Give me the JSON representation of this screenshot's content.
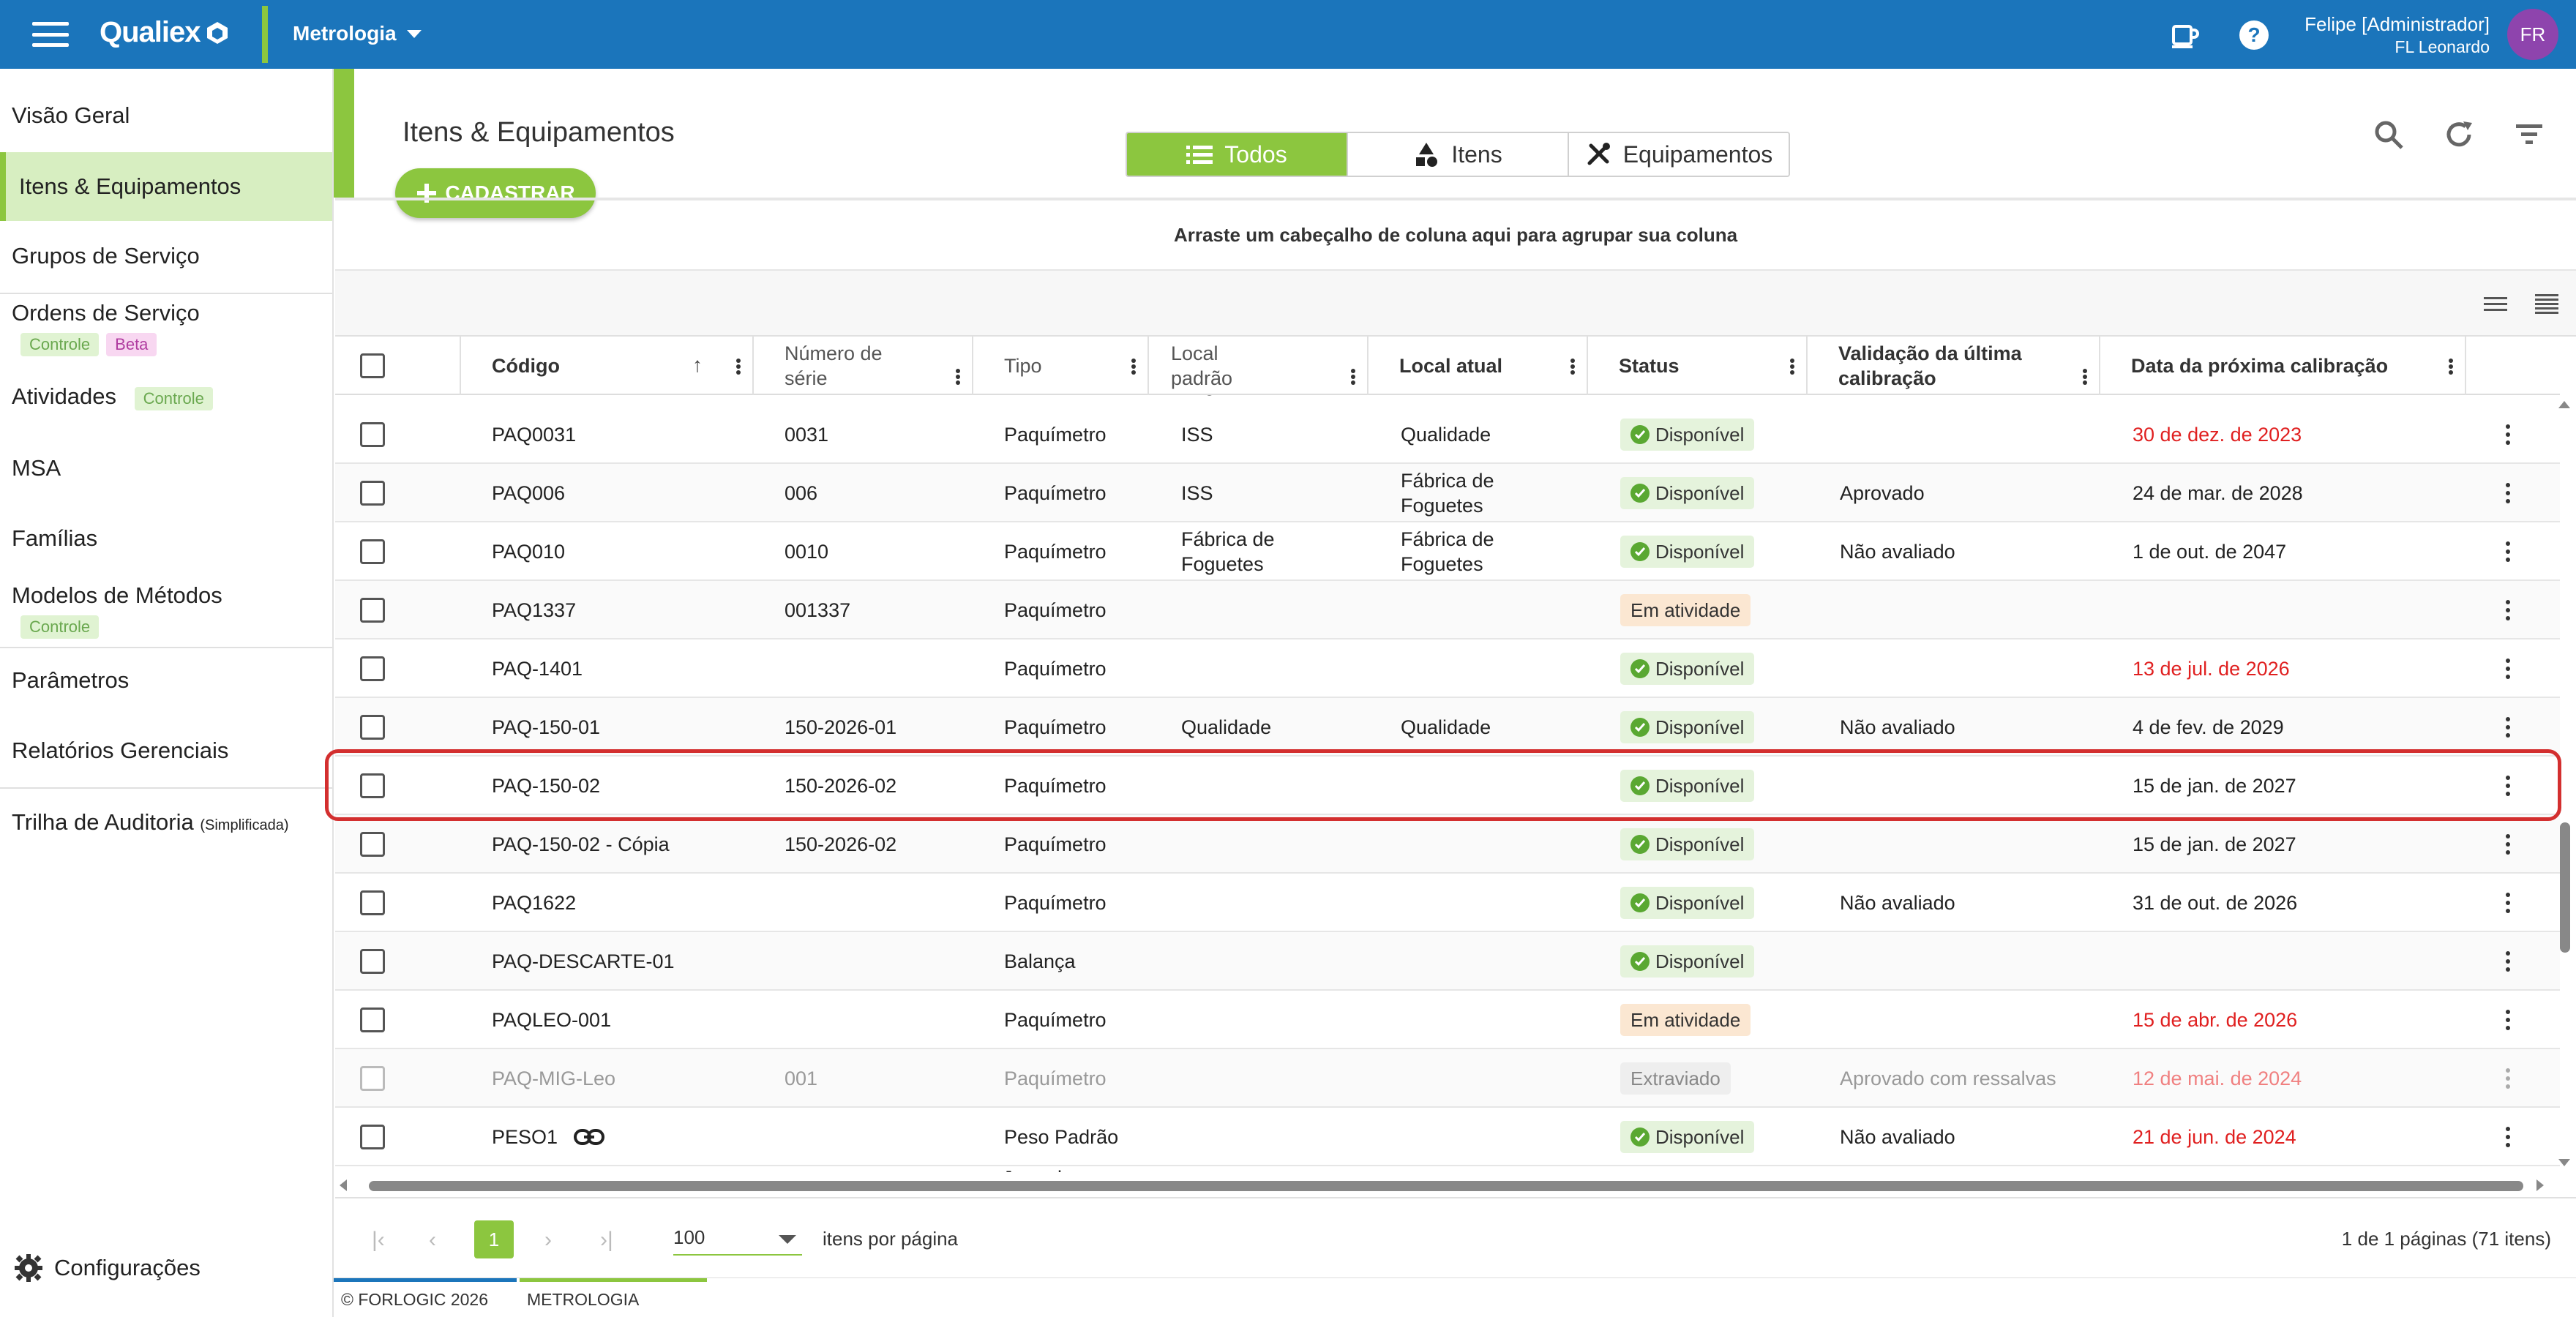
{
  "app": {
    "logo_text": "Qualiex",
    "module": "Metrologia",
    "user_name": "Felipe [Administrador]",
    "user_sub": "FL Leonardo",
    "avatar_initials": "FR",
    "brand_blue": "#1b75bb",
    "accent_green": "#8cc63f"
  },
  "sidebar": {
    "items": [
      {
        "label": "Visão Geral"
      },
      {
        "label": "Itens & Equipamentos",
        "active": true
      },
      {
        "label": "Grupos de Serviço"
      },
      {
        "label": "Ordens de Serviço",
        "badges": [
          "Controle",
          "Beta"
        ]
      },
      {
        "label": "Atividades",
        "badges": [
          "Controle"
        ]
      },
      {
        "label": "MSA"
      },
      {
        "label": "Famílias"
      },
      {
        "label": "Modelos de Métodos",
        "badges": [
          "Controle"
        ]
      },
      {
        "label": "Parâmetros"
      },
      {
        "label": "Relatórios Gerenciais"
      },
      {
        "label": "Trilha de Auditoria",
        "suffix": "(Simplificada)"
      }
    ],
    "config_label": "Configurações"
  },
  "page": {
    "title": "Itens & Equipamentos",
    "add_button": "CADASTRAR",
    "segments": [
      "Todos",
      "Itens",
      "Equipamentos"
    ],
    "active_segment": "Todos",
    "group_hint": "Arraste um cabeçalho de coluna aqui para agrupar sua coluna"
  },
  "table": {
    "columns": [
      "Código",
      "Número de série",
      "Tipo",
      "Local padrão",
      "Local atual",
      "Status",
      "Validação da última calibração",
      "Data da próxima calibração"
    ],
    "partial_top_text": "Foguetes",
    "partial_bottom_text": "Jogo de",
    "rows": [
      {
        "codigo": "PAQ0031",
        "serie": "0031",
        "tipo": "Paquímetro",
        "local_padrao": "ISS",
        "local_atual": "Qualidade",
        "status": "Disponível",
        "validacao": "",
        "data": "30 de dez. de 2023",
        "overdue": true
      },
      {
        "codigo": "PAQ006",
        "serie": "006",
        "tipo": "Paquímetro",
        "local_padrao": "ISS",
        "local_atual": "Fábrica de Foguetes",
        "status": "Disponível",
        "validacao": "Aprovado",
        "data": "24 de mar. de 2028",
        "overdue": false
      },
      {
        "codigo": "PAQ010",
        "serie": "0010",
        "tipo": "Paquímetro",
        "local_padrao": "Fábrica de Foguetes",
        "local_atual": "Fábrica de Foguetes",
        "status": "Disponível",
        "validacao": "Não avaliado",
        "data": "1 de out. de 2047",
        "overdue": false
      },
      {
        "codigo": "PAQ1337",
        "serie": "001337",
        "tipo": "Paquímetro",
        "local_padrao": "",
        "local_atual": "",
        "status": "Em atividade",
        "validacao": "",
        "data": "",
        "overdue": false
      },
      {
        "codigo": "PAQ-1401",
        "serie": "",
        "tipo": "Paquímetro",
        "local_padrao": "",
        "local_atual": "",
        "status": "Disponível",
        "validacao": "",
        "data": "13 de jul. de 2026",
        "overdue": true
      },
      {
        "codigo": "PAQ-150-01",
        "serie": "150-2026-01",
        "tipo": "Paquímetro",
        "local_padrao": "Qualidade",
        "local_atual": "Qualidade",
        "status": "Disponível",
        "validacao": "Não avaliado",
        "data": "4 de fev. de 2029",
        "overdue": false
      },
      {
        "codigo": "PAQ-150-02",
        "serie": "150-2026-02",
        "tipo": "Paquímetro",
        "local_padrao": "",
        "local_atual": "",
        "status": "Disponível",
        "validacao": "",
        "data": "15 de jan. de 2027",
        "overdue": false,
        "highlighted": true
      },
      {
        "codigo": "PAQ-150-02 - Cópia",
        "serie": "150-2026-02",
        "tipo": "Paquímetro",
        "local_padrao": "",
        "local_atual": "",
        "status": "Disponível",
        "validacao": "",
        "data": "15 de jan. de 2027",
        "overdue": false
      },
      {
        "codigo": "PAQ1622",
        "serie": "",
        "tipo": "Paquímetro",
        "local_padrao": "",
        "local_atual": "",
        "status": "Disponível",
        "validacao": "Não avaliado",
        "data": "31 de out. de 2026",
        "overdue": false
      },
      {
        "codigo": "PAQ-DESCARTE-01",
        "serie": "",
        "tipo": "Balança",
        "local_padrao": "",
        "local_atual": "",
        "status": "Disponível",
        "validacao": "",
        "data": "",
        "overdue": false
      },
      {
        "codigo": "PAQLEO-001",
        "serie": "",
        "tipo": "Paquímetro",
        "local_padrao": "",
        "local_atual": "",
        "status": "Em atividade",
        "validacao": "",
        "data": "15 de abr. de 2026",
        "overdue": true
      },
      {
        "codigo": "PAQ-MIG-Leo",
        "serie": "001",
        "tipo": "Paquímetro",
        "local_padrao": "",
        "local_atual": "",
        "status": "Extraviado",
        "validacao": "Aprovado com ressalvas",
        "data": "12 de mai. de 2024",
        "overdue": true,
        "muted": true
      },
      {
        "codigo": "PESO1",
        "serie": "",
        "tipo": "Peso Padrão",
        "local_padrao": "",
        "local_atual": "",
        "status": "Disponível",
        "validacao": "Não avaliado",
        "data": "21 de jun. de 2024",
        "overdue": true,
        "link_icon": true
      }
    ]
  },
  "pager": {
    "current_page": "1",
    "page_size": "100",
    "page_size_label": "itens por página",
    "info": "1 de 1 páginas (71 itens)"
  },
  "footer": {
    "copyright": "© FORLOGIC 2026",
    "module": "METROLOGIA"
  }
}
